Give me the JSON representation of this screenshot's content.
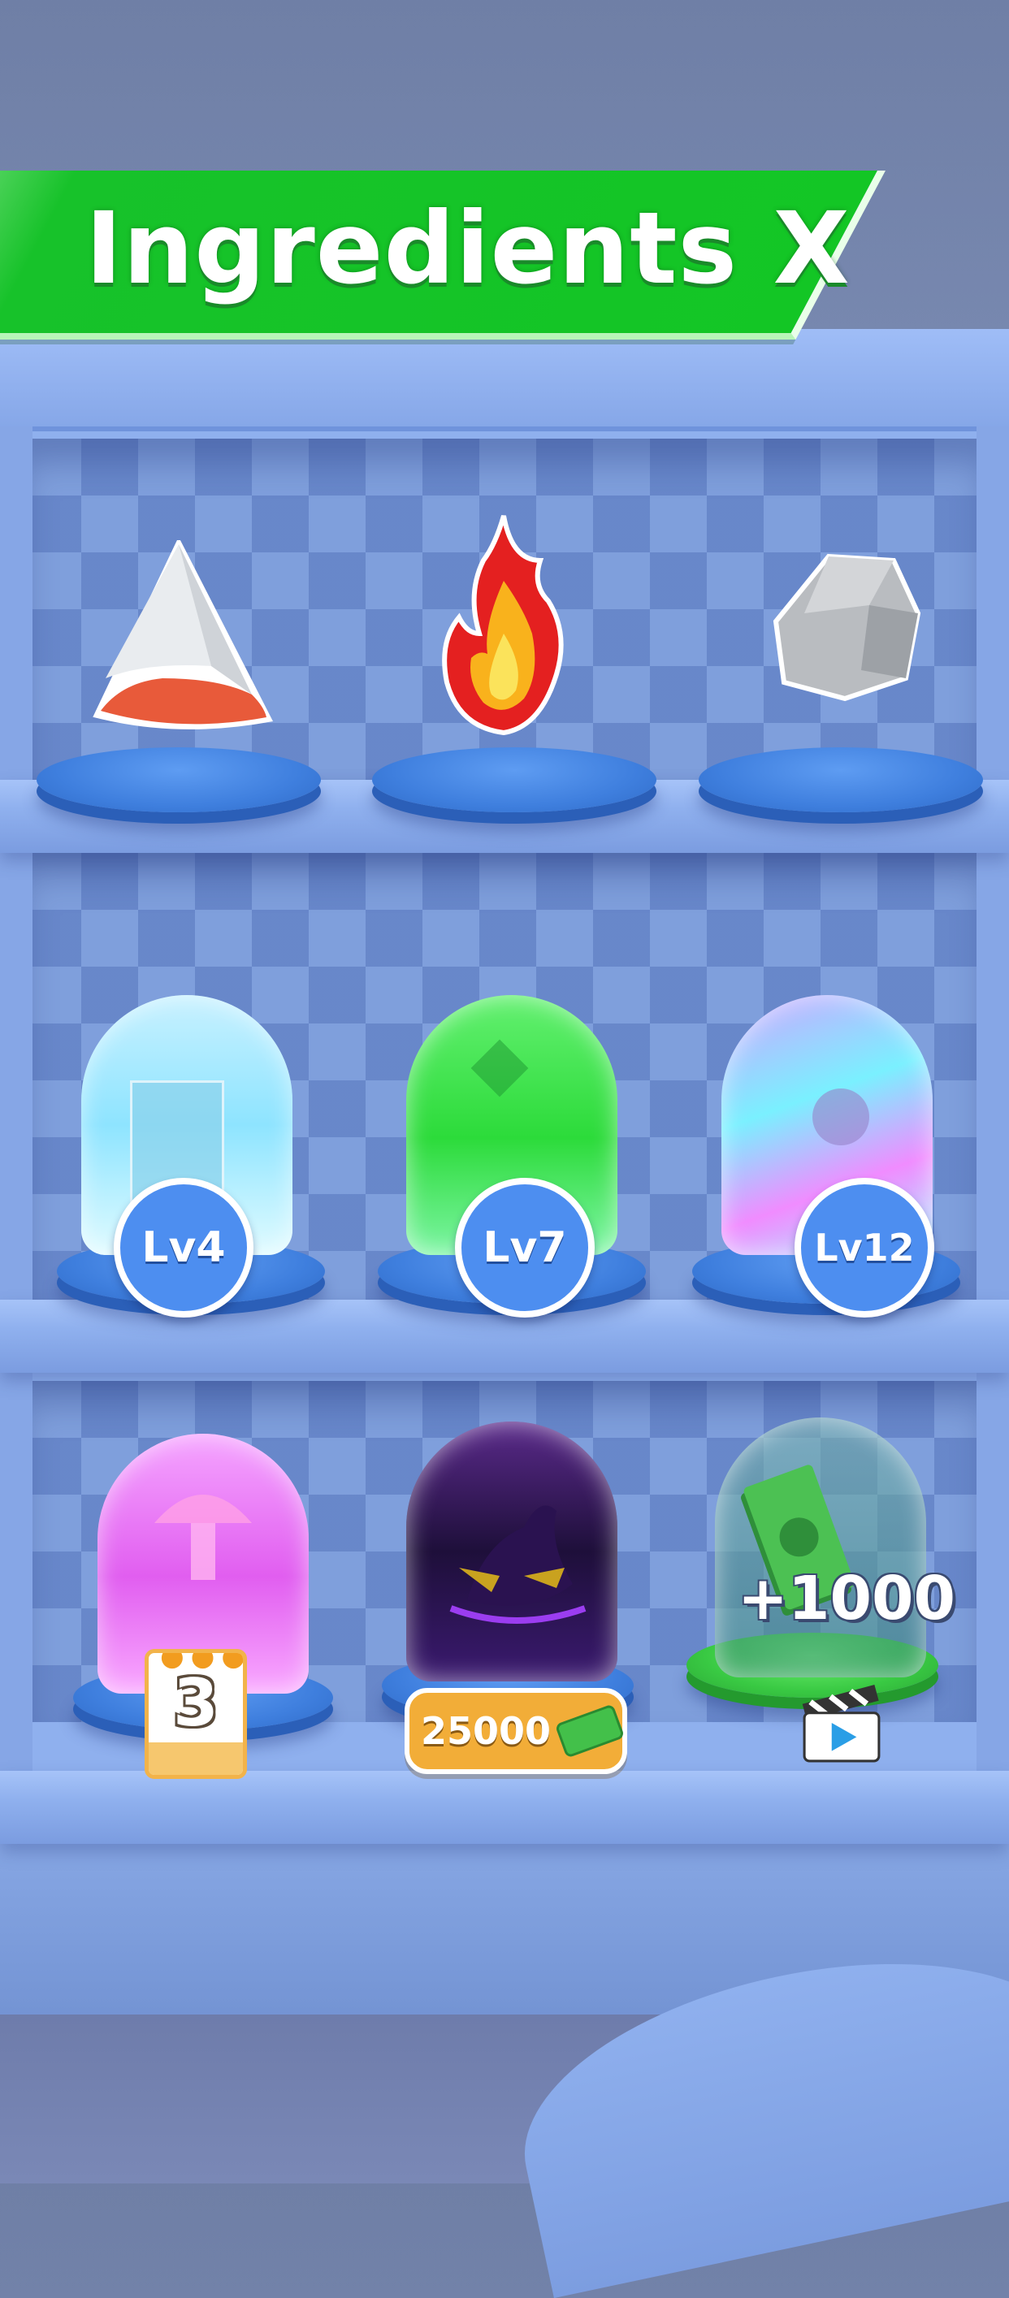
{
  "header": {
    "title": "Ingredients X"
  },
  "shelves": [
    {
      "row": 1,
      "items": [
        {
          "name": "Shark Tooth",
          "icon": "tooth-icon",
          "badge": null
        },
        {
          "name": "Fire",
          "icon": "fire-icon",
          "badge": null
        },
        {
          "name": "Stone",
          "icon": "stone-icon",
          "badge": null
        }
      ]
    },
    {
      "row": 2,
      "items": [
        {
          "name": "Ice Cube",
          "icon": "ice-cube-icon",
          "badge": "Lv4",
          "state": "locked"
        },
        {
          "name": "Green Gem",
          "icon": "gem-icon",
          "badge": "Lv7",
          "state": "locked"
        },
        {
          "name": "Eye",
          "icon": "eye-icon",
          "badge": "Lv12",
          "state": "locked"
        }
      ]
    },
    {
      "row": 3,
      "items": [
        {
          "name": "Mushroom",
          "icon": "mushroom-icon",
          "badge": "3",
          "state": "calendar"
        },
        {
          "name": "Dark Ingredient",
          "icon": "mystery-icon",
          "badge": "25000",
          "state": "buy",
          "currency_icon": "cash-icon"
        },
        {
          "name": "Cash Reward",
          "icon": "money-stack-icon",
          "badge": "+1000",
          "state": "video",
          "action_icon": "video-icon"
        }
      ]
    }
  ],
  "colors": {
    "banner_green": "#13c625",
    "badge_blue": "#4d8ef0",
    "price_orange": "#f2ad38",
    "cabinet_blue": "#8fb0ee"
  }
}
